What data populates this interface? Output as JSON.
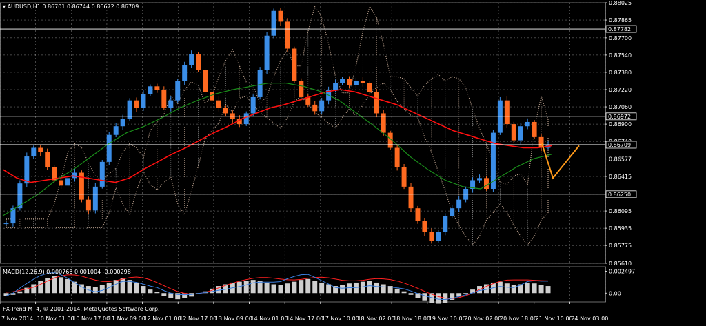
{
  "header": {
    "symbol_line": "AUDUSD,H1  0.86701 0.86744 0.86672 0.86709",
    "macd_line": "MACD(12,26,9) 0.000766 0.001004 -0.000298",
    "copyright": "FX-Trend MT4, © 2001-2014, MetaQuotes Software Corp."
  },
  "colors": {
    "background": "#000000",
    "grid": "#ffffff",
    "bull_candle": "#3b8ee8",
    "bear_candle": "#ff6a20",
    "ma_fast": "#1a8c1a",
    "ma_slow": "#ff1010",
    "cloud_a": "#e8c8b0",
    "cloud_b": "#d0d0d0",
    "zigzag": "#ff9a1a",
    "macd_hist": "#cfcfcf",
    "macd_signal": "#ff2020",
    "macd_main": "#3a7fe0"
  },
  "chart_data": {
    "type": "candlestick",
    "ylim": [
      0.8561,
      0.88025
    ],
    "y_ticks": [
      "0.88025",
      "0.87865",
      "0.87700",
      "0.87540",
      "0.87380",
      "0.87220",
      "0.87060",
      "0.86900",
      "0.86740",
      "0.86577",
      "0.86415",
      "0.86250",
      "0.86095",
      "0.85935",
      "0.85775",
      "0.85610"
    ],
    "x_ticks": [
      "7 Nov 2014",
      "10 Nov 01:00",
      "10 Nov 17:00",
      "11 Nov 09:00",
      "12 Nov 01:00",
      "12 Nov 17:00",
      "13 Nov 09:00",
      "14 Nov 01:00",
      "14 Nov 17:00",
      "17 Nov 10:00",
      "18 Nov 02:00",
      "18 Nov 18:00",
      "19 Nov 10:00",
      "20 Nov 02:00",
      "20 Nov 18:00",
      "21 Nov 10:00",
      "24 Nov 03:00"
    ],
    "horizontal_levels": [
      "0.87782",
      "0.86972",
      "0.86709",
      "0.86250"
    ],
    "current_price": "0.86709",
    "close_series": [
      0.8598,
      0.8612,
      0.8635,
      0.866,
      0.8668,
      0.8664,
      0.865,
      0.8638,
      0.8633,
      0.864,
      0.8645,
      0.862,
      0.861,
      0.8632,
      0.8655,
      0.868,
      0.8688,
      0.8695,
      0.8712,
      0.8705,
      0.8718,
      0.8725,
      0.8722,
      0.8705,
      0.8712,
      0.873,
      0.8745,
      0.8755,
      0.874,
      0.872,
      0.8712,
      0.8705,
      0.87,
      0.8695,
      0.869,
      0.87,
      0.8715,
      0.874,
      0.8772,
      0.8795,
      0.8785,
      0.876,
      0.873,
      0.8715,
      0.8708,
      0.8702,
      0.8712,
      0.8722,
      0.8728,
      0.8732,
      0.8726,
      0.873,
      0.8728,
      0.872,
      0.87,
      0.8682,
      0.8668,
      0.865,
      0.8632,
      0.8612,
      0.86,
      0.859,
      0.8582,
      0.859,
      0.8605,
      0.8612,
      0.862,
      0.863,
      0.8638,
      0.864,
      0.863,
      0.8682,
      0.8712,
      0.869,
      0.8675,
      0.8688,
      0.8692,
      0.8678,
      0.8668,
      0.8671
    ],
    "ma_slow_series": [
      0.8648,
      0.864,
      0.8636,
      0.8638,
      0.864,
      0.8642,
      0.864,
      0.8638,
      0.8636,
      0.864,
      0.8648,
      0.8655,
      0.8662,
      0.8668,
      0.8675,
      0.8682,
      0.8688,
      0.8695,
      0.87,
      0.8705,
      0.8708,
      0.8712,
      0.8716,
      0.872,
      0.8722,
      0.872,
      0.8716,
      0.8712,
      0.8708,
      0.8702,
      0.8696,
      0.869,
      0.8684,
      0.868,
      0.8676,
      0.8672,
      0.867,
      0.8668,
      0.8668,
      0.867
    ],
    "ma_fast_series": [
      0.8605,
      0.8615,
      0.8625,
      0.8638,
      0.8648,
      0.866,
      0.8672,
      0.8682,
      0.8688,
      0.8696,
      0.8705,
      0.8712,
      0.8718,
      0.8722,
      0.8725,
      0.8728,
      0.8728,
      0.8725,
      0.872,
      0.8712,
      0.87,
      0.8688,
      0.8675,
      0.866,
      0.8648,
      0.8638,
      0.8632,
      0.863,
      0.864,
      0.865,
      0.8658,
      0.8662
    ],
    "zigzag_series": [
      0.8672,
      0.864,
      0.867
    ],
    "macd": {
      "ylim": [
        -0.001,
        0.003
      ],
      "y_ticks": [
        "0.002497",
        "0.00"
      ],
      "hist": [
        -0.0003,
        -0.0002,
        0.0002,
        0.0006,
        0.001,
        0.0014,
        0.0017,
        0.0019,
        0.0018,
        0.0016,
        0.0013,
        0.001,
        0.0008,
        0.0007,
        0.0009,
        0.0012,
        0.0015,
        0.0017,
        0.0015,
        0.0012,
        0.0008,
        0.0004,
        0.0001,
        -0.0003,
        -0.0006,
        -0.0007,
        -0.0006,
        -0.0004,
        -0.0001,
        0.0002,
        0.0005,
        0.0008,
        0.001,
        0.0012,
        0.0013,
        0.0014,
        0.0015,
        0.0014,
        0.0012,
        0.001,
        0.0009,
        0.0011,
        0.0013,
        0.0015,
        0.0016,
        0.0014,
        0.0012,
        0.001,
        0.0008,
        0.0009,
        0.0011,
        0.0012,
        0.0013,
        0.0014,
        0.0012,
        0.001,
        0.0008,
        0.0005,
        0.0002,
        -0.0002,
        -0.0006,
        -0.0009,
        -0.0011,
        -0.0012,
        -0.0011,
        -0.0008,
        -0.0004,
        0.0,
        0.0004,
        0.0008,
        0.001,
        0.0012,
        0.0013,
        0.0011,
        0.0009,
        0.001,
        0.0012,
        0.0011,
        0.0009,
        0.0008
      ]
    }
  }
}
